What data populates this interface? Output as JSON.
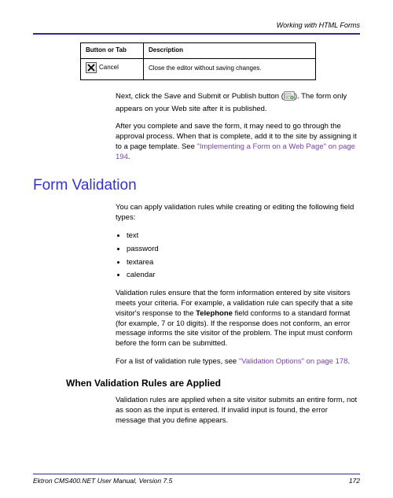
{
  "header": {
    "running_title": "Working with HTML Forms"
  },
  "table": {
    "col1": "Button or Tab",
    "col2": "Description",
    "row1_label": "Cancel",
    "row1_desc": "Close the editor without saving changes."
  },
  "body": {
    "p1a": "Next, click the Save and Submit or Publish button (",
    "p1b": "). The form only appears on your Web site after it is published.",
    "p2a": "After you complete and save the form, it may need to go through the approval process. When that is complete, add it to the site by assigning it to a page template. See ",
    "p2_xref": "\"Implementing a Form on a Web Page\" on page 194",
    "p2b": "."
  },
  "section": {
    "title": "Form Validation",
    "intro": "You can apply validation rules while creating or editing the following field types:",
    "bullets": [
      "text",
      "password",
      "textarea",
      "calendar"
    ],
    "p3a": "Validation rules ensure that the form information entered by site visitors meets your criteria. For example, a validation rule can specify that a site visitor's response to the ",
    "p3_bold": "Telephone",
    "p3b": " field conforms to a standard format (for example, 7 or 10 digits). If the response does not conform, an error message informs the site visitor of the problem. The input must conform before the form can be submitted.",
    "p4a": "For a list of validation rule types, see ",
    "p4_xref": "\"Validation Options\" on page 178",
    "p4b": ".",
    "subhead": "When Validation Rules are Applied",
    "p5": "Validation rules are applied when a site visitor submits an entire form, not as soon as the input is entered. If invalid input is found, the error message that you define appears."
  },
  "footer": {
    "left": "Ektron CMS400.NET User Manual, Version 7.5",
    "right": "172"
  }
}
